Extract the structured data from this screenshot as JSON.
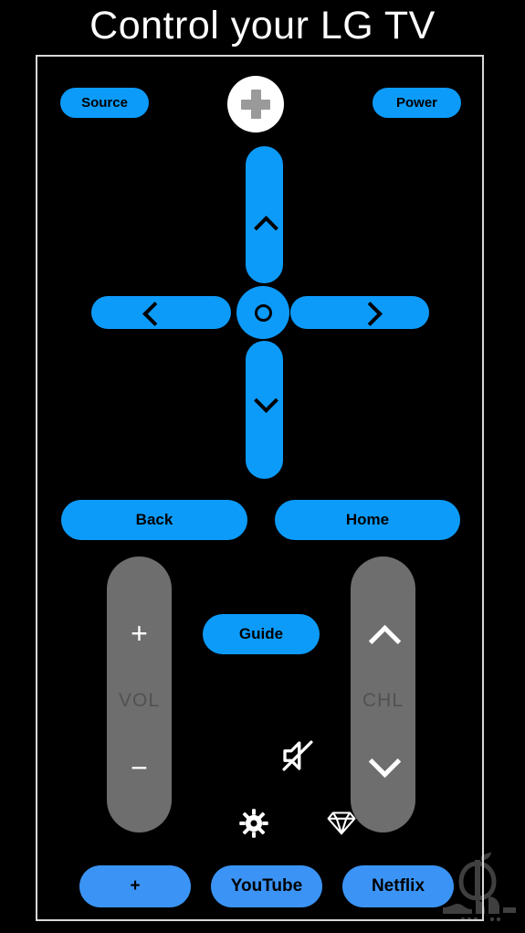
{
  "page": {
    "title": "Control your LG TV",
    "background_color": "#000000",
    "accent_blue": "#0d9bfa",
    "accent_blue_soft": "#3b94f5",
    "rocker_gray": "#6e6e6e",
    "frame_border_color": "#d8d8d8"
  },
  "remote": {
    "top_row": {
      "source_label": "Source",
      "power_label": "Power",
      "center_icon": "plus-circle-icon"
    },
    "dpad": {
      "up_icon": "chevron-up-icon",
      "down_icon": "chevron-down-icon",
      "left_icon": "chevron-left-icon",
      "right_icon": "chevron-right-icon",
      "ok_icon": "ok-ring-icon"
    },
    "nav_row": {
      "back_label": "Back",
      "home_label": "Home"
    },
    "volume_rocker": {
      "plus_symbol": "+",
      "label": "VOL",
      "minus_symbol": "−"
    },
    "channel_rocker": {
      "up_icon": "chevron-up-icon",
      "label": "CHL",
      "down_icon": "chevron-down-icon"
    },
    "center_cluster": {
      "guide_label": "Guide",
      "mute_icon": "mute-speaker-icon",
      "settings_icon": "gear-icon",
      "gem_icon": "diamond-gem-icon"
    },
    "app_row": {
      "plus_label": "+",
      "youtube_label": "YouTube",
      "netflix_label": "Netflix"
    }
  },
  "watermark": {
    "logo_icon": "apple-outline-logo",
    "text": "سارجه"
  }
}
